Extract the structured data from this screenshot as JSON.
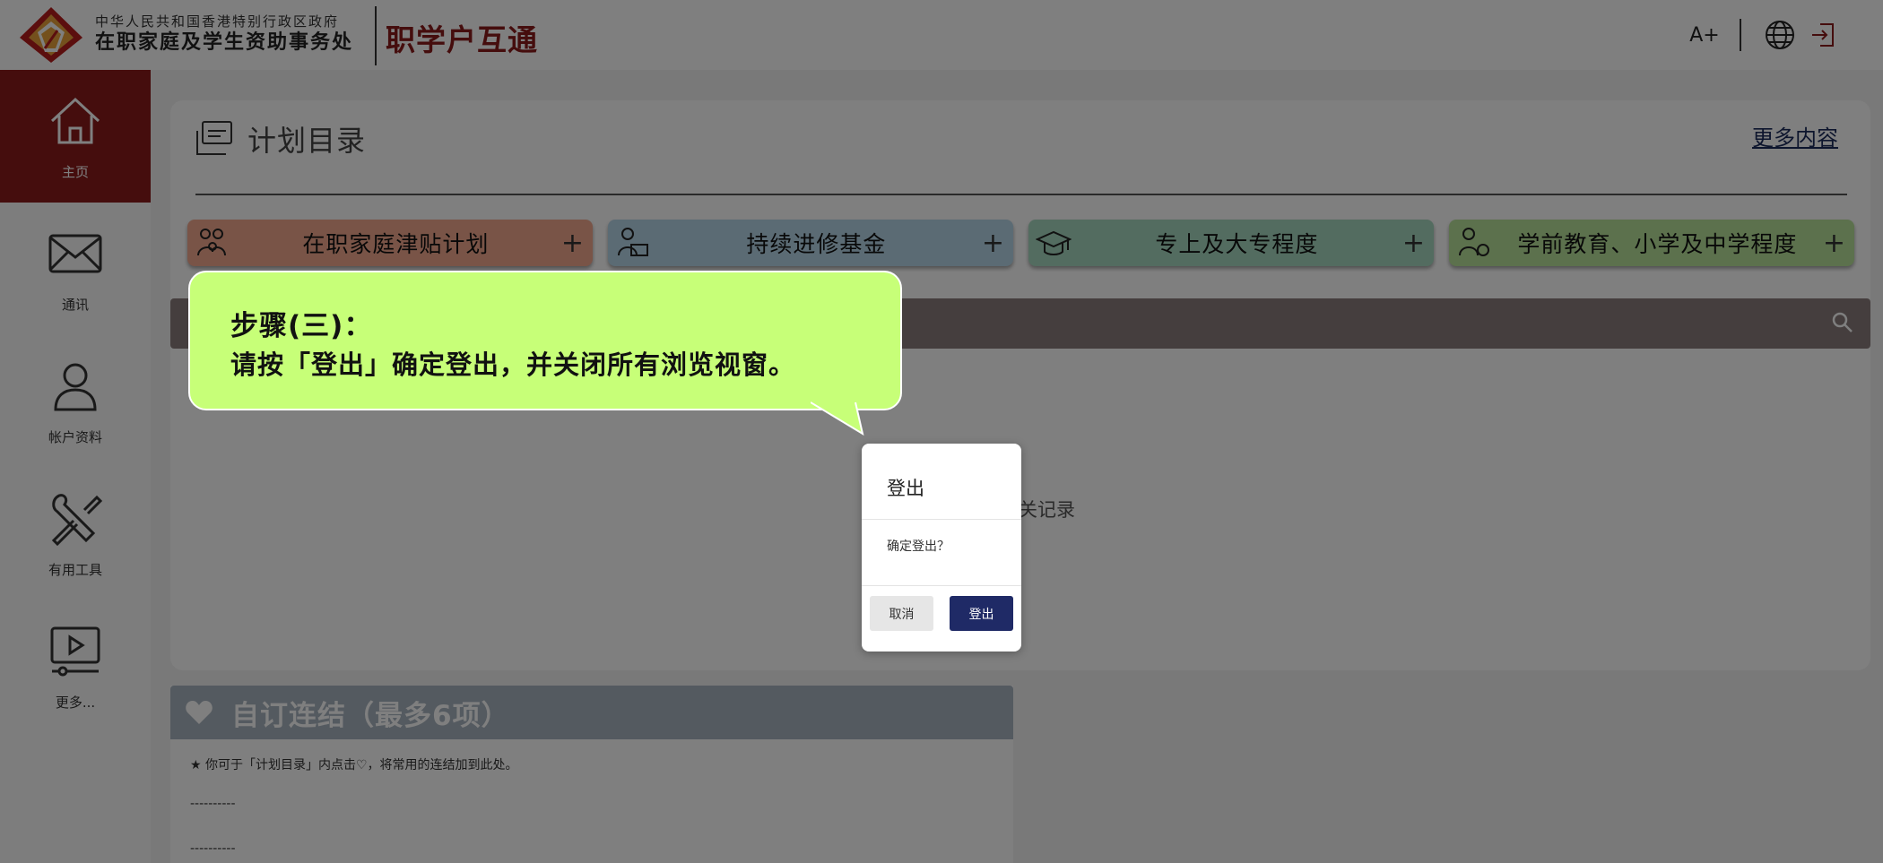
{
  "header": {
    "org_line1": "中华人民共和国香港特别行政区政府",
    "org_line2": "在职家庭及学生资助事务处",
    "app_title": "职学户互通",
    "font_size_label": "A+",
    "icons": [
      "logo-icon",
      "globe-icon",
      "logout-icon"
    ]
  },
  "sidebar": {
    "items": [
      {
        "label": "主页",
        "icon": "home-icon",
        "active": true
      },
      {
        "label": "通讯",
        "icon": "mail-icon",
        "active": false
      },
      {
        "label": "帐户资料",
        "icon": "user-icon",
        "active": false
      },
      {
        "label": "有用工具",
        "icon": "tools-icon",
        "active": false
      },
      {
        "label": "更多...",
        "icon": "video-icon",
        "active": false
      }
    ]
  },
  "main": {
    "title": "计划目录",
    "more_link": "更多内容",
    "tiles": [
      {
        "label": "在职家庭津贴计划",
        "color": "#f2a98f",
        "icon": "family-icon"
      },
      {
        "label": "持续进修基金",
        "color": "#b7d6e8",
        "icon": "study-icon"
      },
      {
        "label": "专上及大专程度",
        "color": "#a6d8c0",
        "icon": "graduation-icon"
      },
      {
        "label": "学前教育、小学及中学程度",
        "color": "#b8e29a",
        "icon": "student-icon"
      }
    ],
    "empty_text": "关记录"
  },
  "links": {
    "title": "自订连结（最多6项）",
    "note": "★ 你可于「计划目录」内点击♡，将常用的连结加到此处。",
    "placeholders": [
      "----------",
      "----------"
    ]
  },
  "callout": {
    "step": "步骤(三)：",
    "text": "请按「登出」确定登出，并关闭所有浏览视窗。",
    "color": "#c7ff78"
  },
  "dialog": {
    "title": "登出",
    "message": "确定登出？",
    "cancel_label": "取消",
    "confirm_label": "登出",
    "confirm_color": "#1f2a66"
  },
  "colors": {
    "brand": "#8b1a1a",
    "search_bar": "#8a7d7c",
    "links_header": "#a9b5c0"
  }
}
